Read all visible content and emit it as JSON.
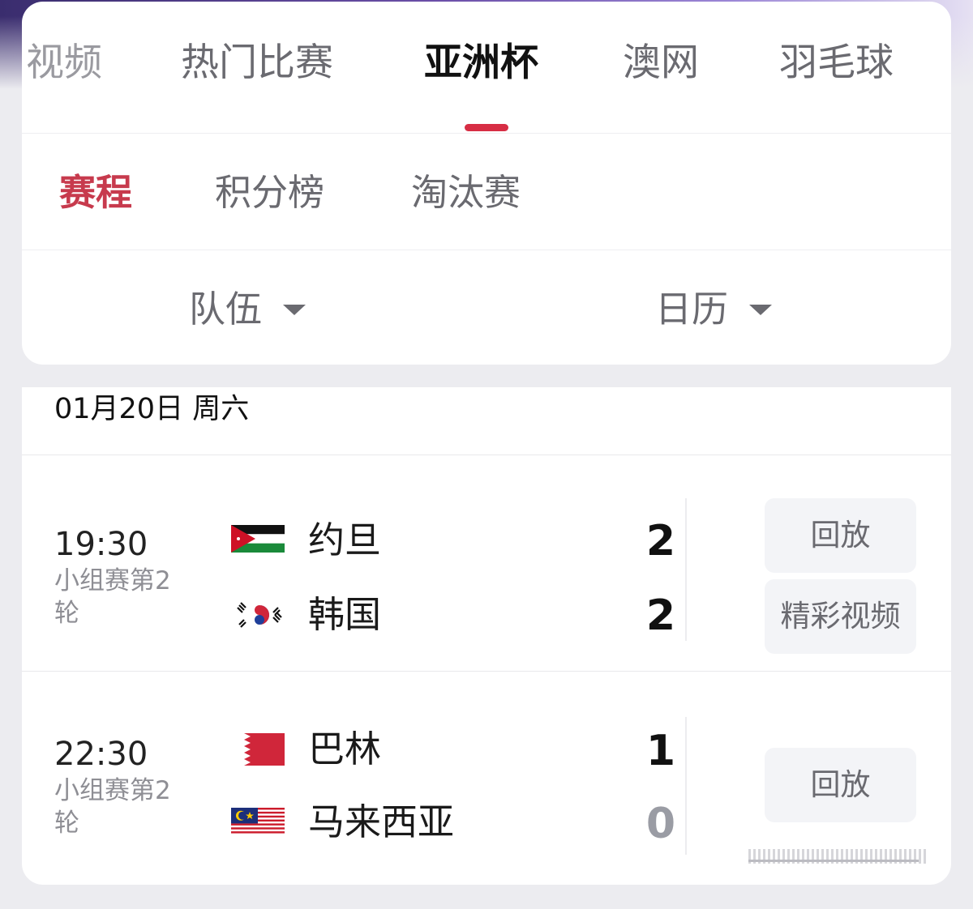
{
  "main_tabs": [
    {
      "label": "视频"
    },
    {
      "label": "热门比赛"
    },
    {
      "label": "亚洲杯"
    },
    {
      "label": "澳网"
    },
    {
      "label": "羽毛球"
    }
  ],
  "active_main_tab": "亚洲杯",
  "sub_tabs": [
    {
      "label": "赛程"
    },
    {
      "label": "积分榜"
    },
    {
      "label": "淘汰赛"
    }
  ],
  "active_sub_tab": "赛程",
  "filters": [
    {
      "label": "队伍"
    },
    {
      "label": "日历"
    }
  ],
  "date_header": "01月20日 周六",
  "matches": [
    {
      "time": "19:30",
      "round": "小组赛第2轮",
      "home": {
        "name": "约旦",
        "flag": "jordan-flag-icon",
        "score": "2"
      },
      "away": {
        "name": "韩国",
        "flag": "south-korea-flag-icon",
        "score": "2"
      },
      "actions": [
        "回放",
        "精彩视频"
      ]
    },
    {
      "time": "22:30",
      "round": "小组赛第2轮",
      "home": {
        "name": "巴林",
        "flag": "bahrain-flag-icon",
        "score": "1"
      },
      "away": {
        "name": "马来西亚",
        "flag": "malaysia-flag-icon",
        "score": "0"
      },
      "actions": [
        "回放"
      ]
    }
  ],
  "colors": {
    "accent": "#d72d44",
    "active_subtab": "#c73a4d",
    "muted_text": "#6a6a70",
    "button_bg": "#f3f4f7",
    "page_bg": "#ececf0"
  }
}
